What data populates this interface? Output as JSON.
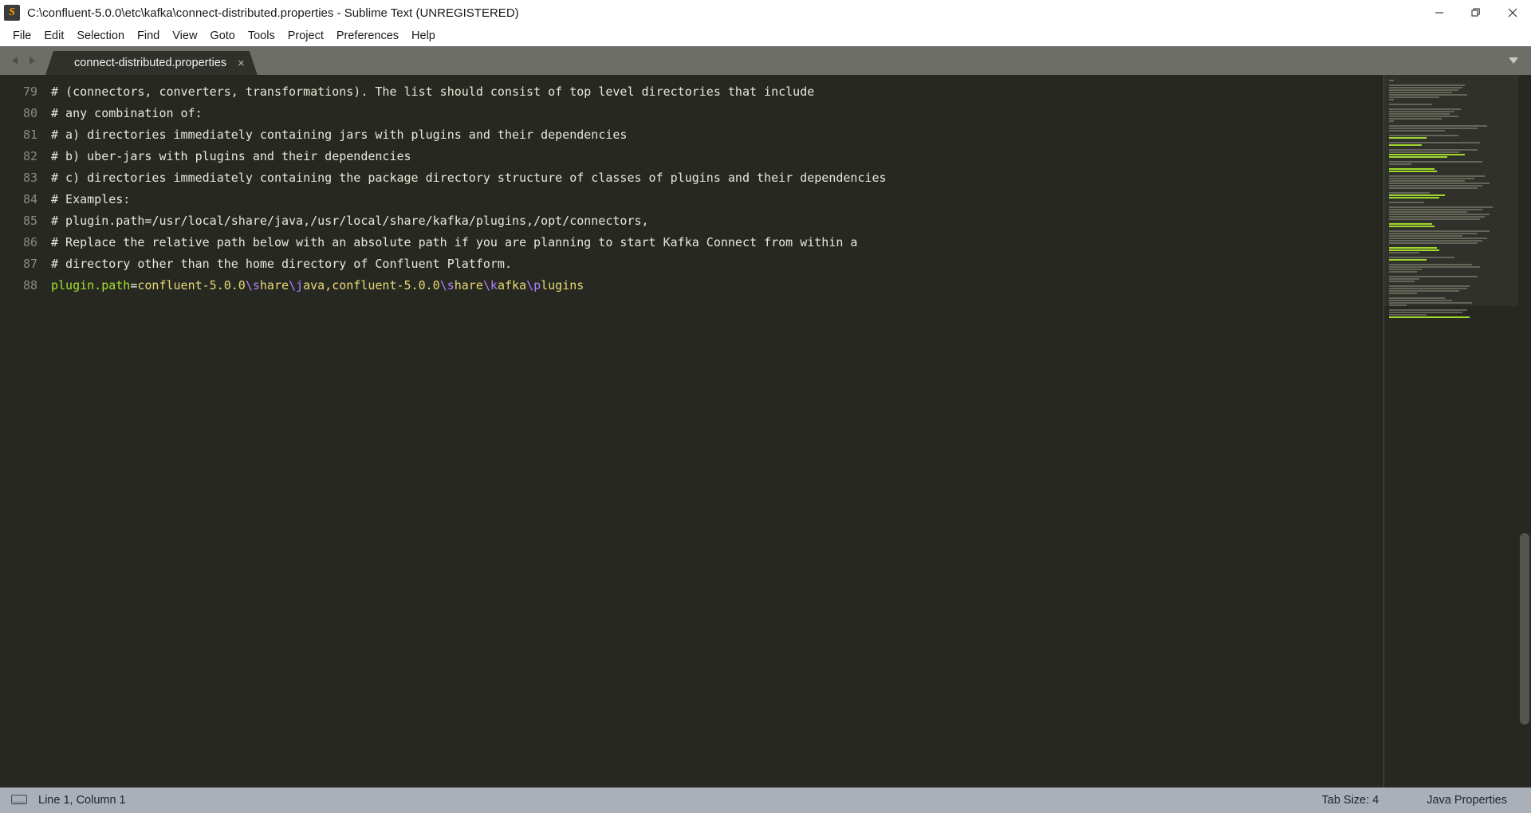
{
  "window": {
    "title": "C:\\confluent-5.0.0\\etc\\kafka\\connect-distributed.properties - Sublime Text (UNREGISTERED)",
    "app_icon": "sublime-text-logo-icon",
    "controls": {
      "minimize": "minimize-icon",
      "restore": "restore-icon",
      "close": "close-icon"
    }
  },
  "menubar": {
    "items": [
      {
        "label": "File"
      },
      {
        "label": "Edit"
      },
      {
        "label": "Selection"
      },
      {
        "label": "Find"
      },
      {
        "label": "View"
      },
      {
        "label": "Goto"
      },
      {
        "label": "Tools"
      },
      {
        "label": "Project"
      },
      {
        "label": "Preferences"
      },
      {
        "label": "Help"
      }
    ]
  },
  "tabbar": {
    "prev_icon": "triangle-left-icon",
    "next_icon": "triangle-right-icon",
    "dropdown_icon": "chevron-down-icon",
    "tabs": [
      {
        "label": "connect-distributed.properties",
        "close": "×",
        "active": true
      }
    ]
  },
  "editor": {
    "first_line_number": 79,
    "lines": [
      {
        "number": "79",
        "type": "comment",
        "text": "# (connectors, converters, transformations). The list should consist of top level directories that include"
      },
      {
        "number": "80",
        "type": "comment",
        "text": "# any combination of:"
      },
      {
        "number": "81",
        "type": "comment",
        "text": "# a) directories immediately containing jars with plugins and their dependencies"
      },
      {
        "number": "82",
        "type": "comment",
        "text": "# b) uber-jars with plugins and their dependencies"
      },
      {
        "number": "83",
        "type": "comment",
        "text": "# c) directories immediately containing the package directory structure of classes of plugins and their dependencies"
      },
      {
        "number": "84",
        "type": "comment",
        "text": "# Examples:"
      },
      {
        "number": "85",
        "type": "comment",
        "text": "# plugin.path=/usr/local/share/java,/usr/local/share/kafka/plugins,/opt/connectors,"
      },
      {
        "number": "86",
        "type": "comment",
        "text": "# Replace the relative path below with an absolute path if you are planning to start Kafka Connect from within a"
      },
      {
        "number": "87",
        "type": "comment",
        "text": "# directory other than the home directory of Confluent Platform."
      },
      {
        "number": "88",
        "type": "property",
        "text": "plugin.path=confluent-5.0.0\\share\\java,confluent-5.0.0\\share\\kafka\\plugins",
        "tokens": [
          {
            "t": "plugin.path",
            "c": "key"
          },
          {
            "t": "=",
            "c": "op"
          },
          {
            "t": "confluent-5.0.0",
            "c": "val"
          },
          {
            "t": "\\s",
            "c": "esc"
          },
          {
            "t": "hare",
            "c": "val"
          },
          {
            "t": "\\j",
            "c": "esc"
          },
          {
            "t": "ava,confluent-5.0.0",
            "c": "val"
          },
          {
            "t": "\\s",
            "c": "esc"
          },
          {
            "t": "hare",
            "c": "val"
          },
          {
            "t": "\\k",
            "c": "esc"
          },
          {
            "t": "afka",
            "c": "val"
          },
          {
            "t": "\\p",
            "c": "esc"
          },
          {
            "t": "lugins",
            "c": "val"
          }
        ]
      }
    ]
  },
  "minimap": {
    "name": "code-minimap"
  },
  "scrollbar": {
    "name": "vertical-scrollbar"
  },
  "statusbar": {
    "encoding_icon": "monitor-icon",
    "cursor_position": "Line 1, Column 1",
    "tab_size": "Tab Size: 4",
    "syntax": "Java Properties"
  },
  "colors": {
    "editor_bg": "#272822",
    "chrome_bg": "#6e6e68",
    "tab_active_bg": "#31312b",
    "statusbar_bg": "#aab0b8",
    "comment": "#90907e",
    "key": "#a6e22e",
    "value": "#e6db74",
    "escape": "#ae81ff",
    "line_number": "#8a8a80",
    "accent_orange": "#ff9800"
  }
}
